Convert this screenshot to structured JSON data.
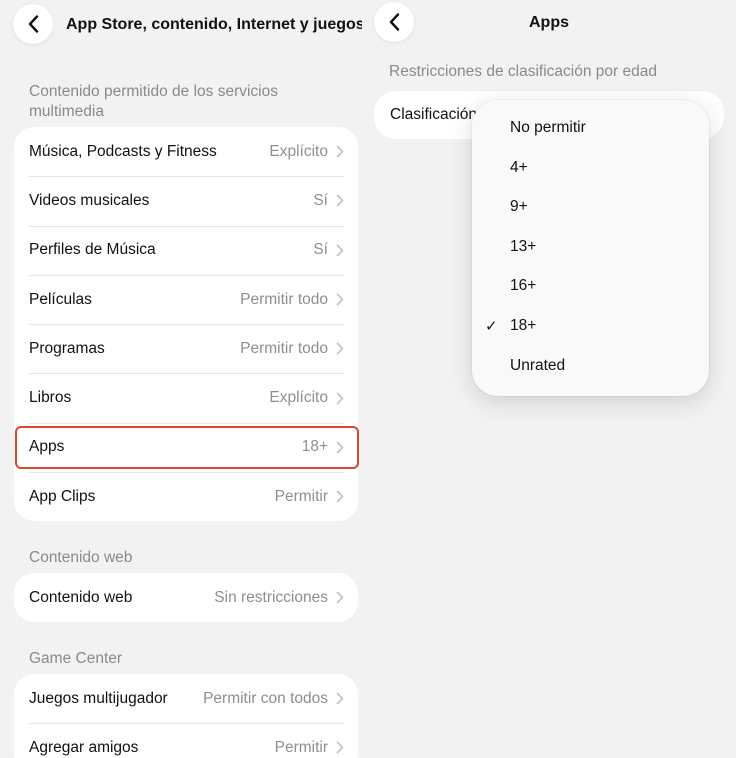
{
  "left": {
    "title": "App Store, contenido, Internet y juegos",
    "sections": [
      {
        "header": "Contenido permitido de los servicios multimedia",
        "rows": [
          {
            "label": "Música, Podcasts y Fitness",
            "value": "Explícito"
          },
          {
            "label": "Videos musicales",
            "value": "Sí"
          },
          {
            "label": "Perfiles de Música",
            "value": "Sí"
          },
          {
            "label": "Películas",
            "value": "Permitir todo"
          },
          {
            "label": "Programas",
            "value": "Permitir todo"
          },
          {
            "label": "Libros",
            "value": "Explícito"
          },
          {
            "label": "Apps",
            "value": "18+"
          },
          {
            "label": "App Clips",
            "value": "Permitir"
          }
        ]
      },
      {
        "header": "Contenido web",
        "rows": [
          {
            "label": "Contenido web",
            "value": "Sin restricciones"
          }
        ]
      },
      {
        "header": "Game Center",
        "rows": [
          {
            "label": "Juegos multijugador",
            "value": "Permitir con todos"
          },
          {
            "label": "Agregar amigos",
            "value": "Permitir"
          }
        ]
      }
    ]
  },
  "right": {
    "title": "Apps",
    "section_header": "Restricciones de clasificación por edad",
    "rating_label": "Clasificación",
    "menu": {
      "options": [
        {
          "label": "No permitir",
          "selected": false
        },
        {
          "label": "4+",
          "selected": false
        },
        {
          "label": "9+",
          "selected": false
        },
        {
          "label": "13+",
          "selected": false
        },
        {
          "label": "16+",
          "selected": false
        },
        {
          "label": "18+",
          "selected": true
        },
        {
          "label": "Unrated",
          "selected": false
        }
      ],
      "check_glyph": "✓"
    }
  },
  "colors": {
    "background": "#f2f2f2",
    "card": "#ffffff",
    "secondary_text": "#8e8e93",
    "highlight": "#e0452e"
  },
  "icons": {
    "back": "chevron-left-icon",
    "row_disclosure": "chevron-right-icon",
    "selected": "checkmark-icon"
  }
}
